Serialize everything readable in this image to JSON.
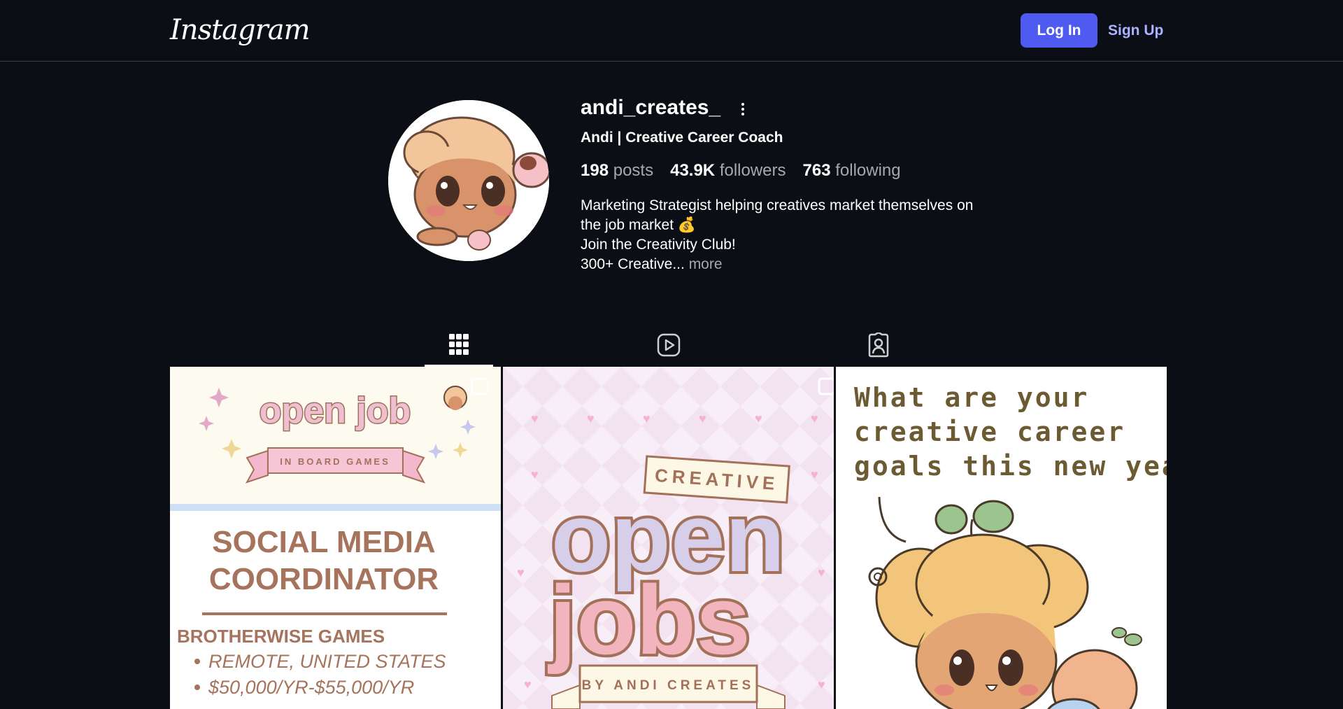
{
  "header": {
    "logo": "Instagram",
    "login_label": "Log In",
    "signup_label": "Sign Up",
    "accent": "#4f5bf0"
  },
  "profile": {
    "username": "andi_creates_",
    "full_name": "Andi | Creative Career Coach",
    "stats": {
      "posts_count": "198",
      "posts_label": "posts",
      "followers_count": "43.9K",
      "followers_label": "followers",
      "following_count": "763",
      "following_label": "following"
    },
    "bio": {
      "line1": "Marketing Strategist helping creatives market themselves on",
      "line2": "the job market 💰",
      "line3": "Join the Creativity Club!",
      "line4": "300+ Creative...",
      "more": "more"
    }
  },
  "tabs": [
    {
      "icon": "grid-icon",
      "active": true
    },
    {
      "icon": "reels-icon",
      "active": false
    },
    {
      "icon": "tagged-icon",
      "active": false
    }
  ],
  "posts": [
    {
      "title_top": "open job",
      "ribbon": "IN BOARD GAMES",
      "role_line1": "SOCIAL MEDIA",
      "role_line2": "COORDINATOR",
      "company": "BROTHERWISE GAMES",
      "bullet1": "REMOTE, UNITED STATES",
      "bullet2": "$50,000/YR-$55,000/YR"
    },
    {
      "tag": "CREATIVE",
      "word1": "open",
      "word2": "jobs",
      "byline": "BY ANDI CREATES"
    },
    {
      "question_l1": "What are your",
      "question_l2": "creative career",
      "question_l3": "goals this new year?"
    }
  ]
}
